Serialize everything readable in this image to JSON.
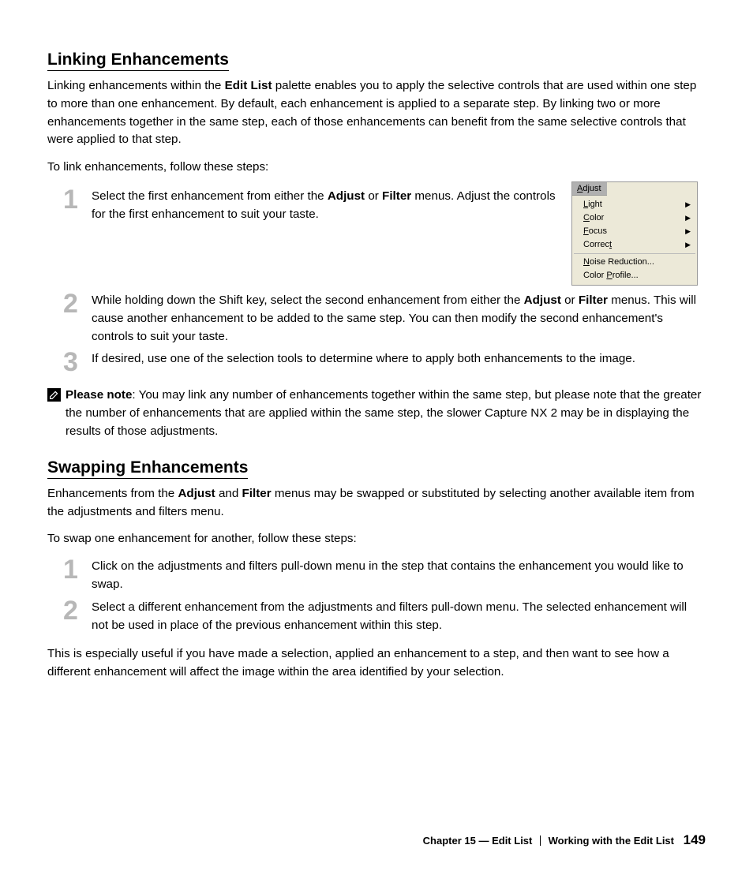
{
  "section1": {
    "title": "Linking Enhancements",
    "intro_pre": "Linking enhancements within the ",
    "intro_bold": "Edit List",
    "intro_post": " palette enables you to apply the selective controls that are used within one step to more than one enhancement. By default, each enhancement is applied to a separate step. By linking two or more enhancements together in the same step, each of those enhancements can benefit from the same selective controls that were applied to that step.",
    "lead": "To link enhancements, follow these steps:",
    "steps": {
      "s1_num": "1",
      "s1_a": "Select the first enhancement from either the ",
      "s1_b1": "Adjust",
      "s1_b": " or ",
      "s1_b2": "Filter",
      "s1_c": " menus. Adjust the controls for the first enhancement to suit your taste.",
      "s2_num": "2",
      "s2_a": "While holding down the Shift key, select the second enhancement from either the ",
      "s2_b1": "Adjust",
      "s2_b": " or ",
      "s2_b2": "Filter",
      "s2_c": " menus. This will cause another enhancement to be added to the same step. You can then modify the second enhancement's controls to suit your taste.",
      "s3_num": "3",
      "s3": "If desired, use one of the selection tools to determine where to apply both enhancements to the image."
    },
    "menu": {
      "title": "Adjust",
      "items": [
        "Light",
        "Color",
        "Focus",
        "Correct",
        "Noise Reduction...",
        "Color Profile..."
      ]
    },
    "note_label": "Please note",
    "note_body": ": You may link any number of enhancements together within the same step, but please note that the greater the number of enhancements that are applied within the same step, the slower Capture NX 2 may be in displaying the results of those adjustments."
  },
  "section2": {
    "title": "Swapping Enhancements",
    "intro_a": "Enhancements from the ",
    "intro_b1": "Adjust",
    "intro_mid": " and ",
    "intro_b2": "Filter",
    "intro_c": " menus may be swapped or substituted by selecting another available item from the adjustments and filters menu.",
    "lead": "To swap one enhancement for another, follow these steps:",
    "steps": {
      "s1_num": "1",
      "s1": "Click on the adjustments and filters pull-down menu in the step that contains the enhancement you would like to swap.",
      "s2_num": "2",
      "s2": "Select a different enhancement from the adjustments and filters pull-down menu. The selected enhancement will not be used in place of the previous enhancement within this step."
    },
    "outro": "This is especially useful if you have made a selection, applied an enhancement to a step, and then want to see how a different enhancement will affect the image within the area identified by your selection."
  },
  "footer": {
    "chapter": "Chapter 15 — Edit List",
    "section": "Working with the Edit List",
    "page": "149"
  }
}
